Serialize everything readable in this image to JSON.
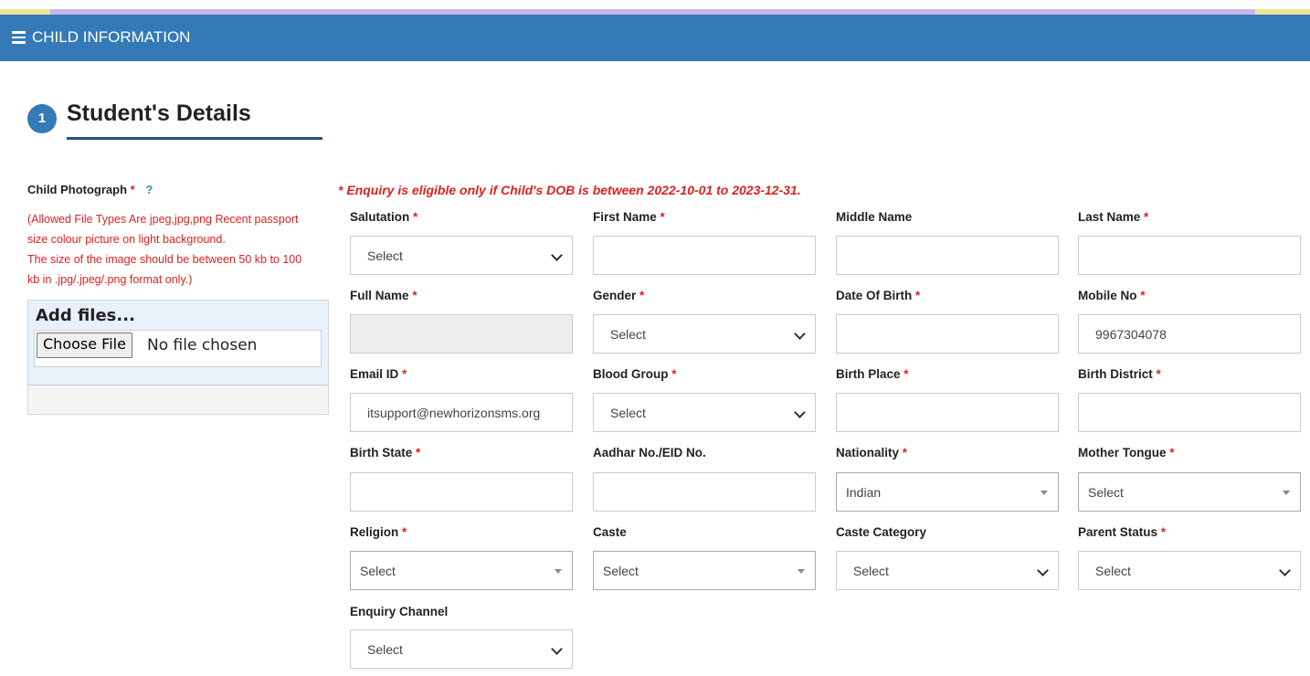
{
  "header": {
    "title": "CHILD INFORMATION"
  },
  "section": {
    "step": "1",
    "title": "Student's Details"
  },
  "photo": {
    "label": "Child Photograph",
    "required": "*",
    "help": "?",
    "note_line1": "(Allowed File Types Are jpeg,jpg,png Recent passport",
    "note_line2": "size colour picture on light background.",
    "note_line3": "The size of the image should be between 50 kb to 100",
    "note_line4": "kb in .jpg/.jpeg/.png format only.)",
    "add_files": "Add files...",
    "choose_file": "Choose File",
    "no_file": "No file chosen"
  },
  "notice": "* Enquiry is eligible only if Child's DOB is between 2022-10-01 to 2023-12-31.",
  "req": "*",
  "fields": {
    "salutation": {
      "label": "Salutation",
      "value": "Select"
    },
    "first_name": {
      "label": "First Name",
      "value": ""
    },
    "middle_name": {
      "label": "Middle Name",
      "value": ""
    },
    "last_name": {
      "label": "Last Name",
      "value": ""
    },
    "full_name": {
      "label": "Full Name",
      "value": ""
    },
    "gender": {
      "label": "Gender",
      "value": "Select"
    },
    "dob": {
      "label": "Date Of Birth",
      "value": ""
    },
    "mobile": {
      "label": "Mobile No",
      "value": "9967304078"
    },
    "email": {
      "label": "Email ID",
      "value": "itsupport@newhorizonsms.org"
    },
    "blood_group": {
      "label": "Blood Group",
      "value": "Select"
    },
    "birth_place": {
      "label": "Birth Place",
      "value": ""
    },
    "birth_district": {
      "label": "Birth District",
      "value": ""
    },
    "birth_state": {
      "label": "Birth State",
      "value": ""
    },
    "aadhar": {
      "label": "Aadhar No./EID No.",
      "value": ""
    },
    "nationality": {
      "label": "Nationality",
      "value": "Indian"
    },
    "mother_tongue": {
      "label": "Mother Tongue",
      "value": "Select"
    },
    "religion": {
      "label": "Religion",
      "value": "Select"
    },
    "caste": {
      "label": "Caste",
      "value": "Select"
    },
    "caste_category": {
      "label": "Caste Category",
      "value": "Select"
    },
    "parent_status": {
      "label": "Parent Status",
      "value": "Select"
    },
    "enquiry_channel": {
      "label": "Enquiry Channel",
      "value": "Select"
    }
  },
  "colors": {
    "header": "#337ab7",
    "required": "#e02020",
    "underline": "#22527f"
  },
  "icons": {
    "menu": "hamburger-icon",
    "dropdown": "chevron-down-icon",
    "select2": "caret-down-icon"
  }
}
